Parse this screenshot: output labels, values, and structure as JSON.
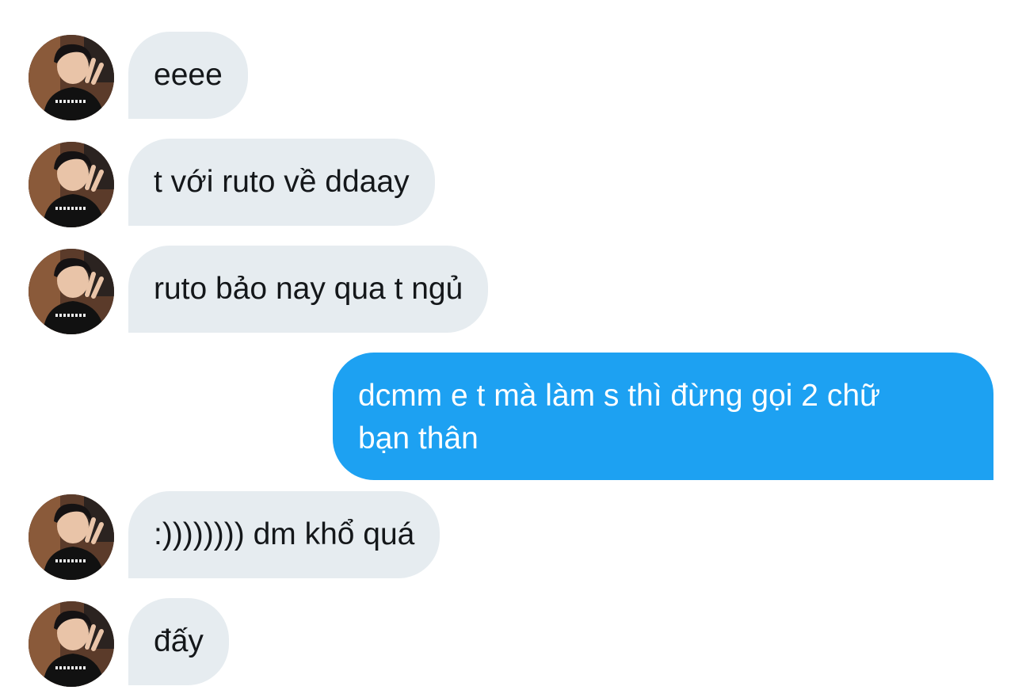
{
  "colors": {
    "incoming_bubble": "#e6ecf0",
    "incoming_text": "#14171a",
    "outgoing_bubble": "#1da1f2",
    "outgoing_text": "#ffffff"
  },
  "messages": [
    {
      "direction": "incoming",
      "text": "eeee",
      "avatar": "user-avatar-photo"
    },
    {
      "direction": "incoming",
      "text": "t với ruto về ddaay",
      "avatar": "user-avatar-photo"
    },
    {
      "direction": "incoming",
      "text": "ruto bảo nay qua t ngủ",
      "avatar": "user-avatar-photo"
    },
    {
      "direction": "outgoing",
      "lines": [
        "dcmm e t mà làm s thì đừng gọi 2 chữ",
        "bạn thân"
      ]
    },
    {
      "direction": "incoming",
      "text": ":)))))))) dm khổ quá",
      "avatar": "user-avatar-photo"
    },
    {
      "direction": "incoming",
      "text": "đấy",
      "avatar": "user-avatar-photo"
    }
  ]
}
